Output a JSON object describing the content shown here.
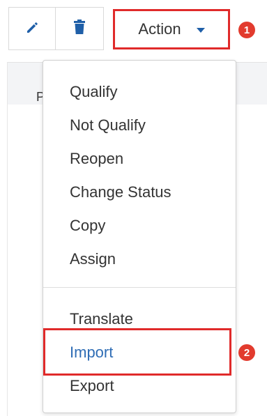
{
  "toolbar": {
    "edit_icon": "pencil-icon",
    "delete_icon": "trash-icon",
    "action_label": "Action",
    "action_caret_icon": "caret-down-icon"
  },
  "badges": [
    "1",
    "2"
  ],
  "background": {
    "partial_char": "P"
  },
  "menu": {
    "items": [
      {
        "label": "Qualify"
      },
      {
        "label": "Not Qualify"
      },
      {
        "label": "Reopen"
      },
      {
        "label": "Change Status"
      },
      {
        "label": "Copy"
      },
      {
        "label": "Assign"
      },
      {
        "label": "Translate"
      },
      {
        "label": "Import",
        "highlighted": true
      },
      {
        "label": "Export"
      }
    ]
  },
  "colors": {
    "highlight_border": "#e02a2a",
    "badge": "#e23b2e",
    "icon_blue": "#1f5fa8",
    "link_blue": "#2f6db5"
  }
}
